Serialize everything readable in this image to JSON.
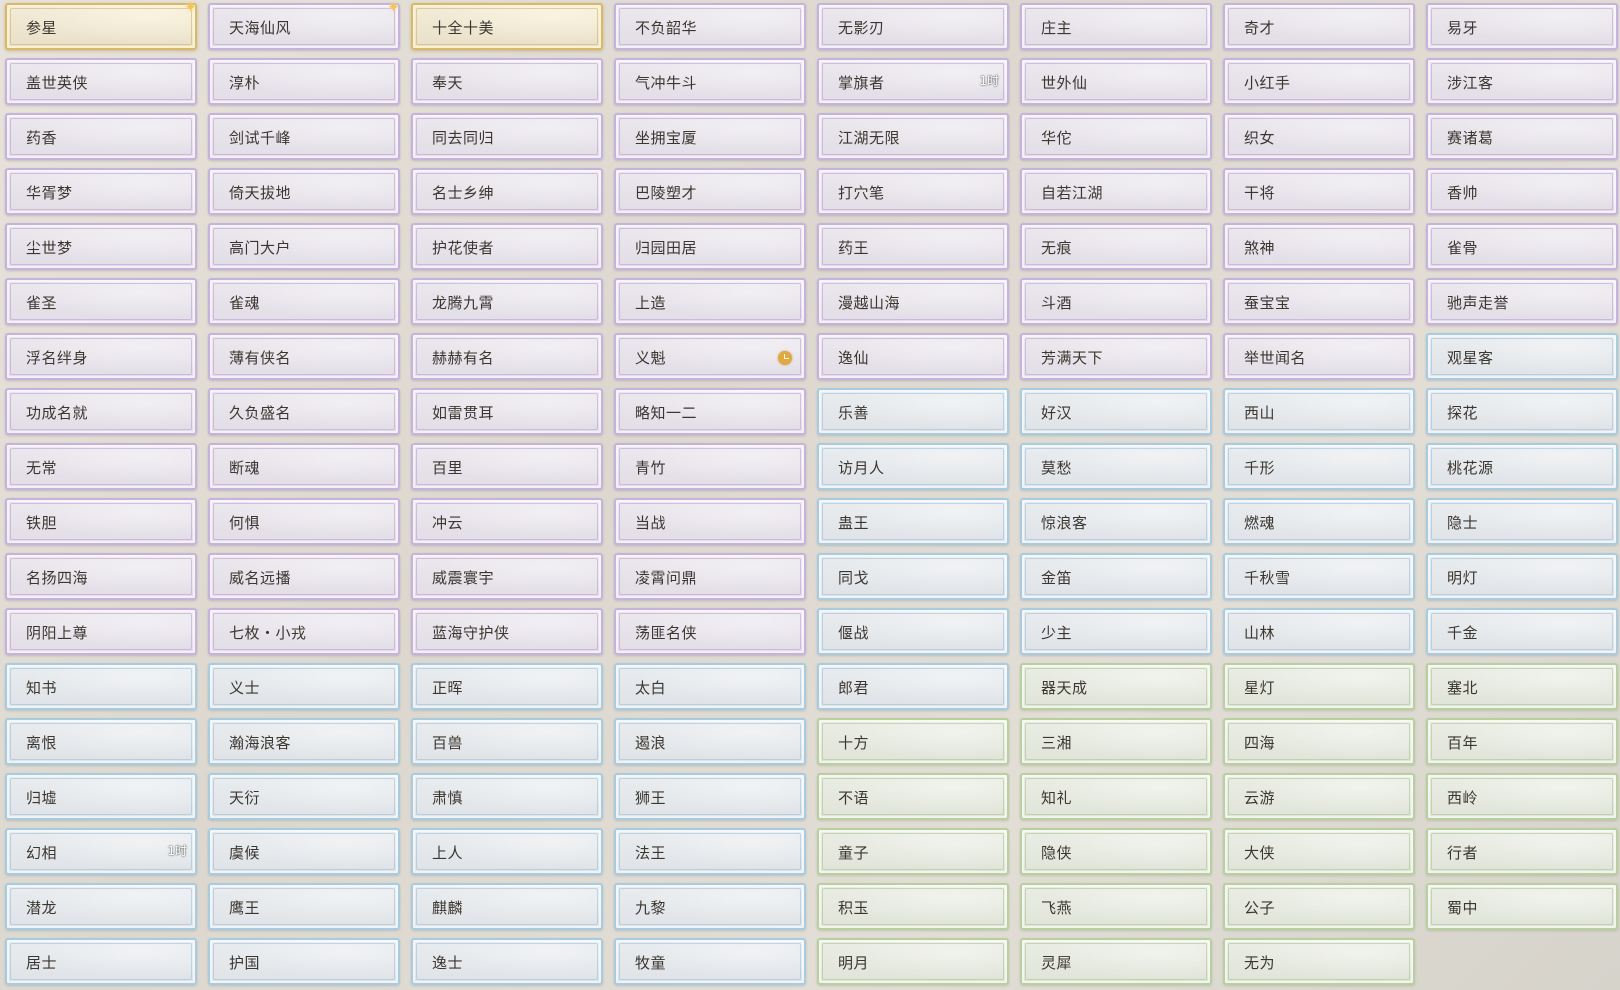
{
  "colors": {
    "gold": "#d9b86a",
    "purple": "#c6b3dd",
    "blue": "#a9cbe0",
    "green": "#b8cf9f",
    "text": "#3c3630"
  },
  "titles": [
    [
      {
        "label": "参星",
        "tier": "gold",
        "badge": "sparkle-icon"
      },
      {
        "label": "天海仙风",
        "tier": "purple",
        "badge": "sparkle-icon"
      },
      {
        "label": "十全十美",
        "tier": "gold"
      },
      {
        "label": "不负韶华",
        "tier": "purple"
      },
      {
        "label": "无影刃",
        "tier": "purple"
      },
      {
        "label": "庄主",
        "tier": "purple"
      },
      {
        "label": "奇才",
        "tier": "purple"
      },
      {
        "label": "易牙",
        "tier": "purple"
      }
    ],
    [
      {
        "label": "盖世英侠",
        "tier": "purple"
      },
      {
        "label": "淳朴",
        "tier": "purple"
      },
      {
        "label": "奉天",
        "tier": "purple"
      },
      {
        "label": "气冲牛斗",
        "tier": "purple"
      },
      {
        "label": "掌旗者",
        "tier": "purple",
        "timer": "1时"
      },
      {
        "label": "世外仙",
        "tier": "purple"
      },
      {
        "label": "小红手",
        "tier": "purple"
      },
      {
        "label": "涉江客",
        "tier": "purple"
      }
    ],
    [
      {
        "label": "药香",
        "tier": "purple"
      },
      {
        "label": "剑试千峰",
        "tier": "purple"
      },
      {
        "label": "同去同归",
        "tier": "purple"
      },
      {
        "label": "坐拥宝厦",
        "tier": "purple"
      },
      {
        "label": "江湖无限",
        "tier": "purple"
      },
      {
        "label": "华佗",
        "tier": "purple"
      },
      {
        "label": "织女",
        "tier": "purple"
      },
      {
        "label": "赛诸葛",
        "tier": "purple"
      }
    ],
    [
      {
        "label": "华胥梦",
        "tier": "purple"
      },
      {
        "label": "倚天拔地",
        "tier": "purple"
      },
      {
        "label": "名士乡绅",
        "tier": "purple"
      },
      {
        "label": "巴陵塑才",
        "tier": "purple"
      },
      {
        "label": "打穴笔",
        "tier": "purple"
      },
      {
        "label": "自若江湖",
        "tier": "purple"
      },
      {
        "label": "干将",
        "tier": "purple"
      },
      {
        "label": "香帅",
        "tier": "purple"
      }
    ],
    [
      {
        "label": "尘世梦",
        "tier": "purple"
      },
      {
        "label": "高门大户",
        "tier": "purple"
      },
      {
        "label": "护花使者",
        "tier": "purple"
      },
      {
        "label": "归园田居",
        "tier": "purple"
      },
      {
        "label": "药王",
        "tier": "purple"
      },
      {
        "label": "无痕",
        "tier": "purple"
      },
      {
        "label": "煞神",
        "tier": "purple"
      },
      {
        "label": "雀骨",
        "tier": "purple"
      }
    ],
    [
      {
        "label": "雀圣",
        "tier": "purple"
      },
      {
        "label": "雀魂",
        "tier": "purple"
      },
      {
        "label": "龙腾九霄",
        "tier": "purple"
      },
      {
        "label": "上造",
        "tier": "purple"
      },
      {
        "label": "漫越山海",
        "tier": "purple"
      },
      {
        "label": "斗酒",
        "tier": "purple"
      },
      {
        "label": "蚕宝宝",
        "tier": "purple"
      },
      {
        "label": "驰声走誉",
        "tier": "purple"
      }
    ],
    [
      {
        "label": "浮名绊身",
        "tier": "purple"
      },
      {
        "label": "薄有侠名",
        "tier": "purple"
      },
      {
        "label": "赫赫有名",
        "tier": "purple"
      },
      {
        "label": "义魁",
        "tier": "purple",
        "badge": "clock-icon"
      },
      {
        "label": "逸仙",
        "tier": "purple"
      },
      {
        "label": "芳满天下",
        "tier": "purple"
      },
      {
        "label": "举世闻名",
        "tier": "purple"
      },
      {
        "label": "观星客",
        "tier": "blue"
      }
    ],
    [
      {
        "label": "功成名就",
        "tier": "purple"
      },
      {
        "label": "久负盛名",
        "tier": "purple"
      },
      {
        "label": "如雷贯耳",
        "tier": "purple"
      },
      {
        "label": "略知一二",
        "tier": "purple"
      },
      {
        "label": "乐善",
        "tier": "blue"
      },
      {
        "label": "好汉",
        "tier": "blue"
      },
      {
        "label": "西山",
        "tier": "blue"
      },
      {
        "label": "探花",
        "tier": "blue"
      }
    ],
    [
      {
        "label": "无常",
        "tier": "purple"
      },
      {
        "label": "断魂",
        "tier": "purple"
      },
      {
        "label": "百里",
        "tier": "purple"
      },
      {
        "label": "青竹",
        "tier": "purple"
      },
      {
        "label": "访月人",
        "tier": "blue"
      },
      {
        "label": "莫愁",
        "tier": "blue"
      },
      {
        "label": "千形",
        "tier": "blue"
      },
      {
        "label": "桃花源",
        "tier": "blue"
      }
    ],
    [
      {
        "label": "铁胆",
        "tier": "purple"
      },
      {
        "label": "何惧",
        "tier": "purple"
      },
      {
        "label": "冲云",
        "tier": "purple"
      },
      {
        "label": "当战",
        "tier": "purple"
      },
      {
        "label": "蛊王",
        "tier": "blue"
      },
      {
        "label": "惊浪客",
        "tier": "blue"
      },
      {
        "label": "燃魂",
        "tier": "blue"
      },
      {
        "label": "隐士",
        "tier": "blue"
      }
    ],
    [
      {
        "label": "名扬四海",
        "tier": "purple"
      },
      {
        "label": "威名远播",
        "tier": "purple"
      },
      {
        "label": "威震寰宇",
        "tier": "purple"
      },
      {
        "label": "凌霄问鼎",
        "tier": "purple"
      },
      {
        "label": "同戈",
        "tier": "blue"
      },
      {
        "label": "金笛",
        "tier": "blue"
      },
      {
        "label": "千秋雪",
        "tier": "blue"
      },
      {
        "label": "明灯",
        "tier": "blue"
      }
    ],
    [
      {
        "label": "阴阳上尊",
        "tier": "purple"
      },
      {
        "label": "七枚・小戎",
        "tier": "purple"
      },
      {
        "label": "蓝海守护侠",
        "tier": "purple"
      },
      {
        "label": "荡匪名侠",
        "tier": "purple"
      },
      {
        "label": "偃战",
        "tier": "blue"
      },
      {
        "label": "少主",
        "tier": "blue"
      },
      {
        "label": "山林",
        "tier": "blue"
      },
      {
        "label": "千金",
        "tier": "blue"
      }
    ],
    [
      {
        "label": "知书",
        "tier": "blue"
      },
      {
        "label": "义士",
        "tier": "blue"
      },
      {
        "label": "正晖",
        "tier": "blue"
      },
      {
        "label": "太白",
        "tier": "blue"
      },
      {
        "label": "郎君",
        "tier": "blue"
      },
      {
        "label": "器天成",
        "tier": "green"
      },
      {
        "label": "星灯",
        "tier": "green"
      },
      {
        "label": "塞北",
        "tier": "green"
      }
    ],
    [
      {
        "label": "离恨",
        "tier": "blue"
      },
      {
        "label": "瀚海浪客",
        "tier": "blue"
      },
      {
        "label": "百兽",
        "tier": "blue"
      },
      {
        "label": "遏浪",
        "tier": "blue"
      },
      {
        "label": "十方",
        "tier": "green"
      },
      {
        "label": "三湘",
        "tier": "green"
      },
      {
        "label": "四海",
        "tier": "green"
      },
      {
        "label": "百年",
        "tier": "green"
      }
    ],
    [
      {
        "label": "归墟",
        "tier": "blue"
      },
      {
        "label": "天衍",
        "tier": "blue"
      },
      {
        "label": "肃慎",
        "tier": "blue"
      },
      {
        "label": "狮王",
        "tier": "blue"
      },
      {
        "label": "不语",
        "tier": "green"
      },
      {
        "label": "知礼",
        "tier": "green"
      },
      {
        "label": "云游",
        "tier": "green"
      },
      {
        "label": "西岭",
        "tier": "green"
      }
    ],
    [
      {
        "label": "幻相",
        "tier": "blue",
        "timer": "1时"
      },
      {
        "label": "虞候",
        "tier": "blue"
      },
      {
        "label": "上人",
        "tier": "blue"
      },
      {
        "label": "法王",
        "tier": "blue"
      },
      {
        "label": "童子",
        "tier": "green"
      },
      {
        "label": "隐侠",
        "tier": "green"
      },
      {
        "label": "大侠",
        "tier": "green"
      },
      {
        "label": "行者",
        "tier": "green"
      }
    ],
    [
      {
        "label": "潜龙",
        "tier": "blue"
      },
      {
        "label": "鹰王",
        "tier": "blue"
      },
      {
        "label": "麒麟",
        "tier": "blue"
      },
      {
        "label": "九黎",
        "tier": "blue"
      },
      {
        "label": "积玉",
        "tier": "green"
      },
      {
        "label": "飞燕",
        "tier": "green"
      },
      {
        "label": "公子",
        "tier": "green"
      },
      {
        "label": "蜀中",
        "tier": "green"
      }
    ],
    [
      {
        "label": "居士",
        "tier": "blue"
      },
      {
        "label": "护国",
        "tier": "blue"
      },
      {
        "label": "逸士",
        "tier": "blue"
      },
      {
        "label": "牧童",
        "tier": "blue"
      },
      {
        "label": "明月",
        "tier": "green"
      },
      {
        "label": "灵犀",
        "tier": "green"
      },
      {
        "label": "无为",
        "tier": "green"
      }
    ]
  ]
}
